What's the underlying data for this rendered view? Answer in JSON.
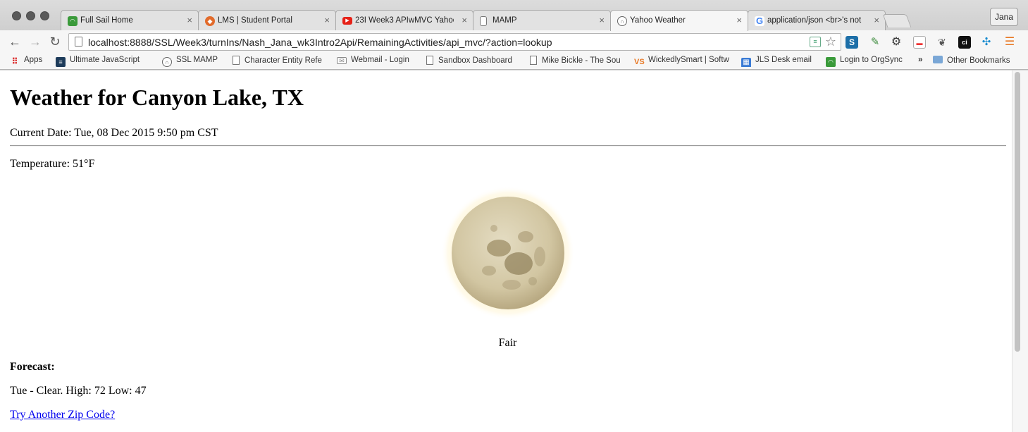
{
  "browser": {
    "tabs": [
      {
        "title": "Full Sail Home",
        "icon": "fullsail-icon",
        "color": "#3a9a3a"
      },
      {
        "title": "LMS | Student Portal",
        "icon": "lms-icon",
        "color": "#e26b2b"
      },
      {
        "title": "23I Week3 APIwMVC Yahoo",
        "icon": "youtube-icon",
        "color": "#e62117"
      },
      {
        "title": "MAMP",
        "icon": "page-icon",
        "color": "#777777"
      },
      {
        "title": "Yahoo Weather",
        "icon": "globe-icon",
        "color": "#666666"
      },
      {
        "title": "application/json <br>'s not",
        "icon": "google-icon",
        "color": "#4285f4"
      }
    ],
    "active_tab": 4,
    "profile": "Jana",
    "url": "localhost:8888/SSL/Week3/turnIns/Nash_Jana_wk3Intro2Api/RemainingActivities/api_mvc/?action=lookup",
    "bookmarks": [
      {
        "label": "Apps",
        "icon": "apps-grid-icon"
      },
      {
        "label": "Ultimate JavaScript",
        "icon": "bookmark-dark-icon"
      },
      {
        "label": "SSL MAMP",
        "icon": "globe-icon"
      },
      {
        "label": "Character Entity Refe",
        "icon": "page-icon"
      },
      {
        "label": "Webmail - Login",
        "icon": "mail-icon"
      },
      {
        "label": "Sandbox Dashboard",
        "icon": "page-icon"
      },
      {
        "label": "Mike Bickle - The Sou",
        "icon": "page-icon"
      },
      {
        "label": "WickedlySmart | Softw",
        "icon": "ws-icon"
      },
      {
        "label": "JLS Desk email",
        "icon": "grid-icon"
      },
      {
        "label": "Login to OrgSync",
        "icon": "orgsync-icon"
      },
      {
        "label": "»",
        "icon": ""
      },
      {
        "label": "Other Bookmarks",
        "icon": "folder-icon"
      }
    ]
  },
  "page": {
    "title": "Weather for Canyon Lake, TX",
    "date": "Current Date: Tue, 08 Dec 2015 9:50 pm CST",
    "temperature": "Temperature: 51°F",
    "condition_image": "moon-icon",
    "condition": "Fair",
    "forecast_label": "Forecast:",
    "forecast": "Tue - Clear. High: 72 Low: 47",
    "link": "Try Another Zip Code?"
  }
}
